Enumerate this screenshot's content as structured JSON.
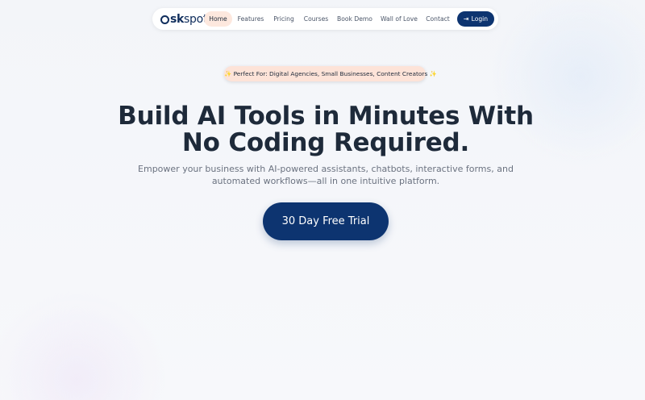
{
  "nav": {
    "logo_text_a": "sk",
    "logo_text_b": "spot",
    "items": [
      {
        "label": "Home",
        "active": true
      },
      {
        "label": "Features"
      },
      {
        "label": "Pricing"
      },
      {
        "label": "Courses"
      },
      {
        "label": "Book Demo"
      },
      {
        "label": "Wall of Love"
      },
      {
        "label": "Contact"
      }
    ],
    "login_label": "Login",
    "login_icon": "login-arrow-icon"
  },
  "badge": {
    "sparkle": "✨",
    "text": "Perfect For: Digital Agencies, Small Businesses, Content Creators"
  },
  "hero": {
    "title_line1": "Build AI Tools in Minutes With",
    "title_line2": "No Coding Required.",
    "subtitle_line1": "Empower your business with AI-powered assistants, chatbots, interactive forms, and",
    "subtitle_line2": "automated workflows—all in one intuitive platform.",
    "cta_label": "30 Day Free Trial"
  },
  "colors": {
    "primary": "#0d3470",
    "active_pill": "#fde8de",
    "badge_bg": "#fde3d8",
    "text_dark": "#1e2a3a",
    "text_muted": "#6b7280"
  }
}
